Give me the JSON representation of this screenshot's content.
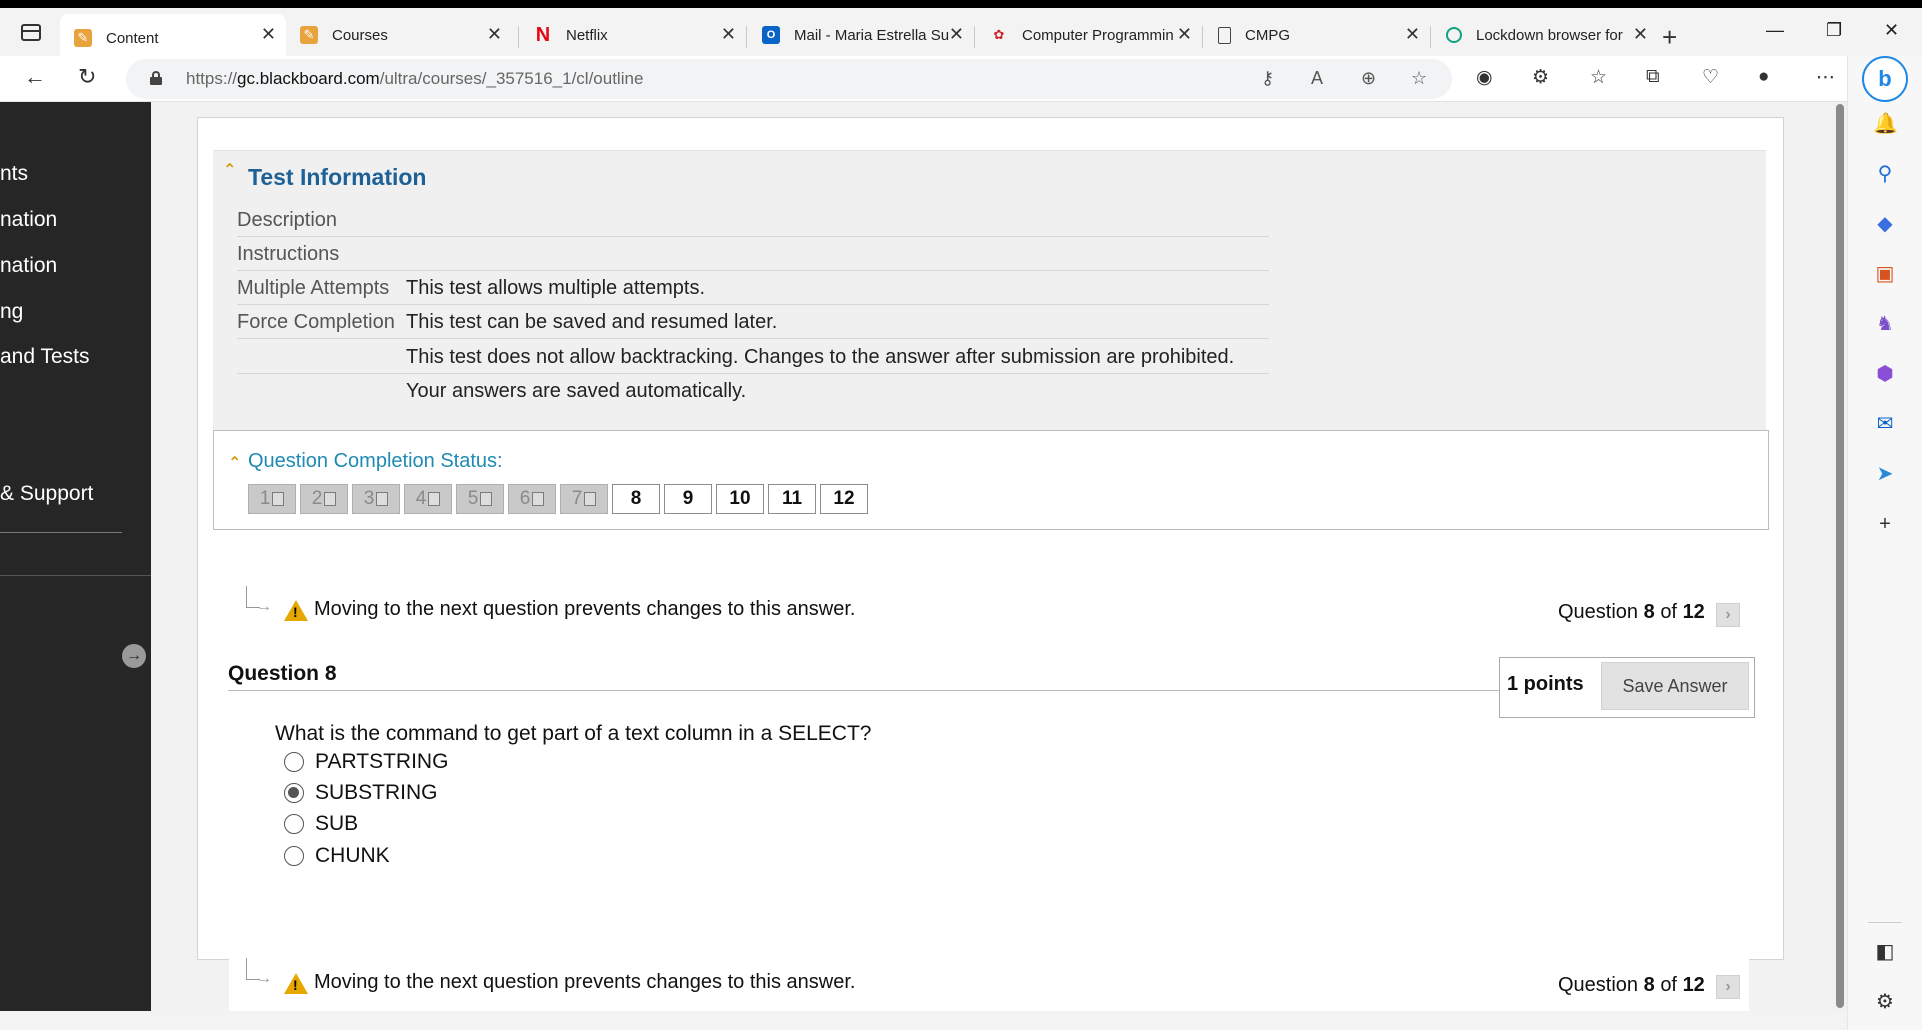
{
  "browser": {
    "tabs": [
      {
        "title": "Content",
        "favicon": "blackboard-favicon",
        "active": true
      },
      {
        "title": "Courses",
        "favicon": "blackboard-favicon",
        "active": false
      },
      {
        "title": "Netflix",
        "favicon": "netflix-favicon",
        "active": false
      },
      {
        "title": "Mail - Maria Estrella Su",
        "favicon": "outlook-favicon",
        "active": false
      },
      {
        "title": "Computer Programmin",
        "favicon": "maple-leaf-favicon",
        "active": false
      },
      {
        "title": "CMPG",
        "favicon": "document-favicon",
        "active": false
      },
      {
        "title": "Lockdown browser for",
        "favicon": "chatgpt-favicon",
        "active": false
      }
    ],
    "url_prefix": "https://",
    "url_host": "gc.blackboard.com",
    "url_path": "/ultra/courses/_357516_1/cl/outline"
  },
  "nav": {
    "items": [
      "nts",
      "nation",
      "nation",
      "ng",
      "and Tests",
      "& Support"
    ]
  },
  "test_info": {
    "title": "Test Information",
    "rows": [
      {
        "label": "Description",
        "value": ""
      },
      {
        "label": "Instructions",
        "value": ""
      },
      {
        "label": "Multiple Attempts",
        "value": "This test allows multiple attempts."
      },
      {
        "label": "Force Completion",
        "value": "This test can be saved and resumed later."
      },
      {
        "label": "",
        "value": "This test does not allow backtracking. Changes to the answer after submission are prohibited."
      },
      {
        "label": "",
        "value": "Your answers are saved automatically."
      }
    ]
  },
  "completion": {
    "title": "Question Completion Status:",
    "questions": [
      {
        "num": "1",
        "answered": true
      },
      {
        "num": "2",
        "answered": true
      },
      {
        "num": "3",
        "answered": true
      },
      {
        "num": "4",
        "answered": true
      },
      {
        "num": "5",
        "answered": true
      },
      {
        "num": "6",
        "answered": true
      },
      {
        "num": "7",
        "answered": true
      },
      {
        "num": "8",
        "answered": false
      },
      {
        "num": "9",
        "answered": false
      },
      {
        "num": "10",
        "answered": false
      },
      {
        "num": "11",
        "answered": false
      },
      {
        "num": "12",
        "answered": false
      }
    ]
  },
  "warning": {
    "text": "Moving to the next question prevents changes to this answer."
  },
  "position": {
    "prefix": "Question",
    "current": "8",
    "of": "of",
    "total": "12"
  },
  "question": {
    "heading": "Question 8",
    "points": "1 points",
    "save_label": "Save Answer",
    "text": "What is the command to get part of a text column in a SELECT?",
    "options": [
      {
        "label": "PARTSTRING",
        "selected": false
      },
      {
        "label": "SUBSTRING",
        "selected": true
      },
      {
        "label": "SUB",
        "selected": false
      },
      {
        "label": "CHUNK",
        "selected": false
      }
    ]
  },
  "colors": {
    "title_blue": "#1d6196",
    "status_teal": "#1f8bb4",
    "nav_bg": "#262626",
    "warning_amber": "#e6a800"
  }
}
